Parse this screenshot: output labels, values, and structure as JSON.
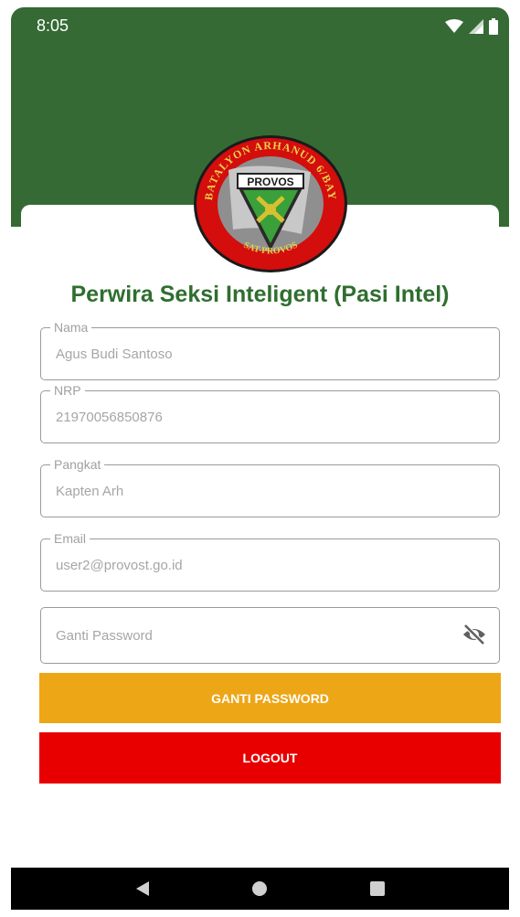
{
  "status_bar": {
    "time": "8:05"
  },
  "logo": {
    "ring_text_top": "BATALYON ARHANUD 6/BAY",
    "ring_text_bottom": "SAT-PROVOS",
    "banner": "PROVOS"
  },
  "profile": {
    "title": "Perwira Seksi Inteligent (Pasi Intel)"
  },
  "form": {
    "nama": {
      "label": "Nama",
      "value": "Agus Budi Santoso"
    },
    "nrp": {
      "label": "NRP",
      "value": "21970056850876"
    },
    "pangkat": {
      "label": "Pangkat",
      "value": "Kapten Arh"
    },
    "email": {
      "label": "Email",
      "value": "user2@provost.go.id"
    },
    "password": {
      "placeholder": "Ganti Password"
    }
  },
  "buttons": {
    "change_password": "GANTI PASSWORD",
    "logout": "LOGOUT"
  },
  "colors": {
    "header": "#356a35",
    "title": "#2f6e2f",
    "gold_button": "#eda616",
    "red_button": "#e80000"
  },
  "icons": [
    "wifi-icon",
    "signal-icon",
    "battery-icon",
    "visibility-off-icon",
    "back-icon",
    "home-icon",
    "recents-icon"
  ]
}
